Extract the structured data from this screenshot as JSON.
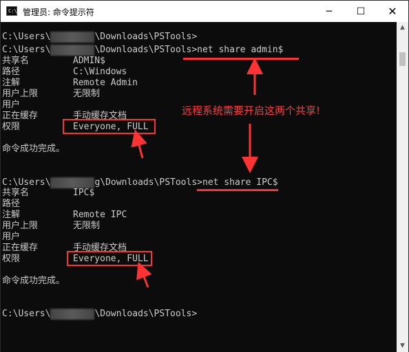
{
  "window": {
    "title": "管理员: 命令提示符",
    "icon_label": "C:\\",
    "minimize_glyph": "─",
    "maximize_glyph": "☐",
    "close_glyph": "✕"
  },
  "console": {
    "block1": {
      "prompt_line1": {
        "before": "C:\\Users\\",
        "after": "\\Downloads\\PSTools>"
      },
      "prompt_line2": {
        "before": "C:\\Users\\",
        "after": "\\Downloads\\PSTools>net share admin$"
      },
      "rows": [
        {
          "key": "共享名",
          "value": "ADMIN$"
        },
        {
          "key": "路径",
          "value": "C:\\Windows"
        },
        {
          "key": "注解",
          "value": "Remote Admin"
        },
        {
          "key": "用户上限",
          "value": "无限制"
        },
        {
          "key": "用户",
          "value": ""
        },
        {
          "key": "正在缓存",
          "value": "手动缓存文档"
        },
        {
          "key": "权限",
          "value": "Everyone, FULL"
        }
      ],
      "success": "命令成功完成。"
    },
    "block2": {
      "prompt_line": {
        "before": "C:\\Users\\",
        "blur_tail": "g",
        "after": "\\Downloads\\PSTools>net share IPC$"
      },
      "rows": [
        {
          "key": "共享名",
          "value": "IPC$"
        },
        {
          "key": "路径",
          "value": ""
        },
        {
          "key": "注解",
          "value": "Remote IPC"
        },
        {
          "key": "用户上限",
          "value": "无限制"
        },
        {
          "key": "用户",
          "value": ""
        },
        {
          "key": "正在缓存",
          "value": "手动缓存文档"
        },
        {
          "key": "权限",
          "value": "Everyone, FULL"
        }
      ],
      "success": "命令成功完成。"
    },
    "final_prompt": {
      "before": "C:\\Users\\",
      "after": "\\Downloads\\PSTools>"
    }
  },
  "annotation": {
    "text": "远程系统需要开启这两个共享!",
    "color": "#ff3333"
  },
  "colors": {
    "console_bg": "#0c0c0c",
    "console_fg": "#cccccc"
  }
}
